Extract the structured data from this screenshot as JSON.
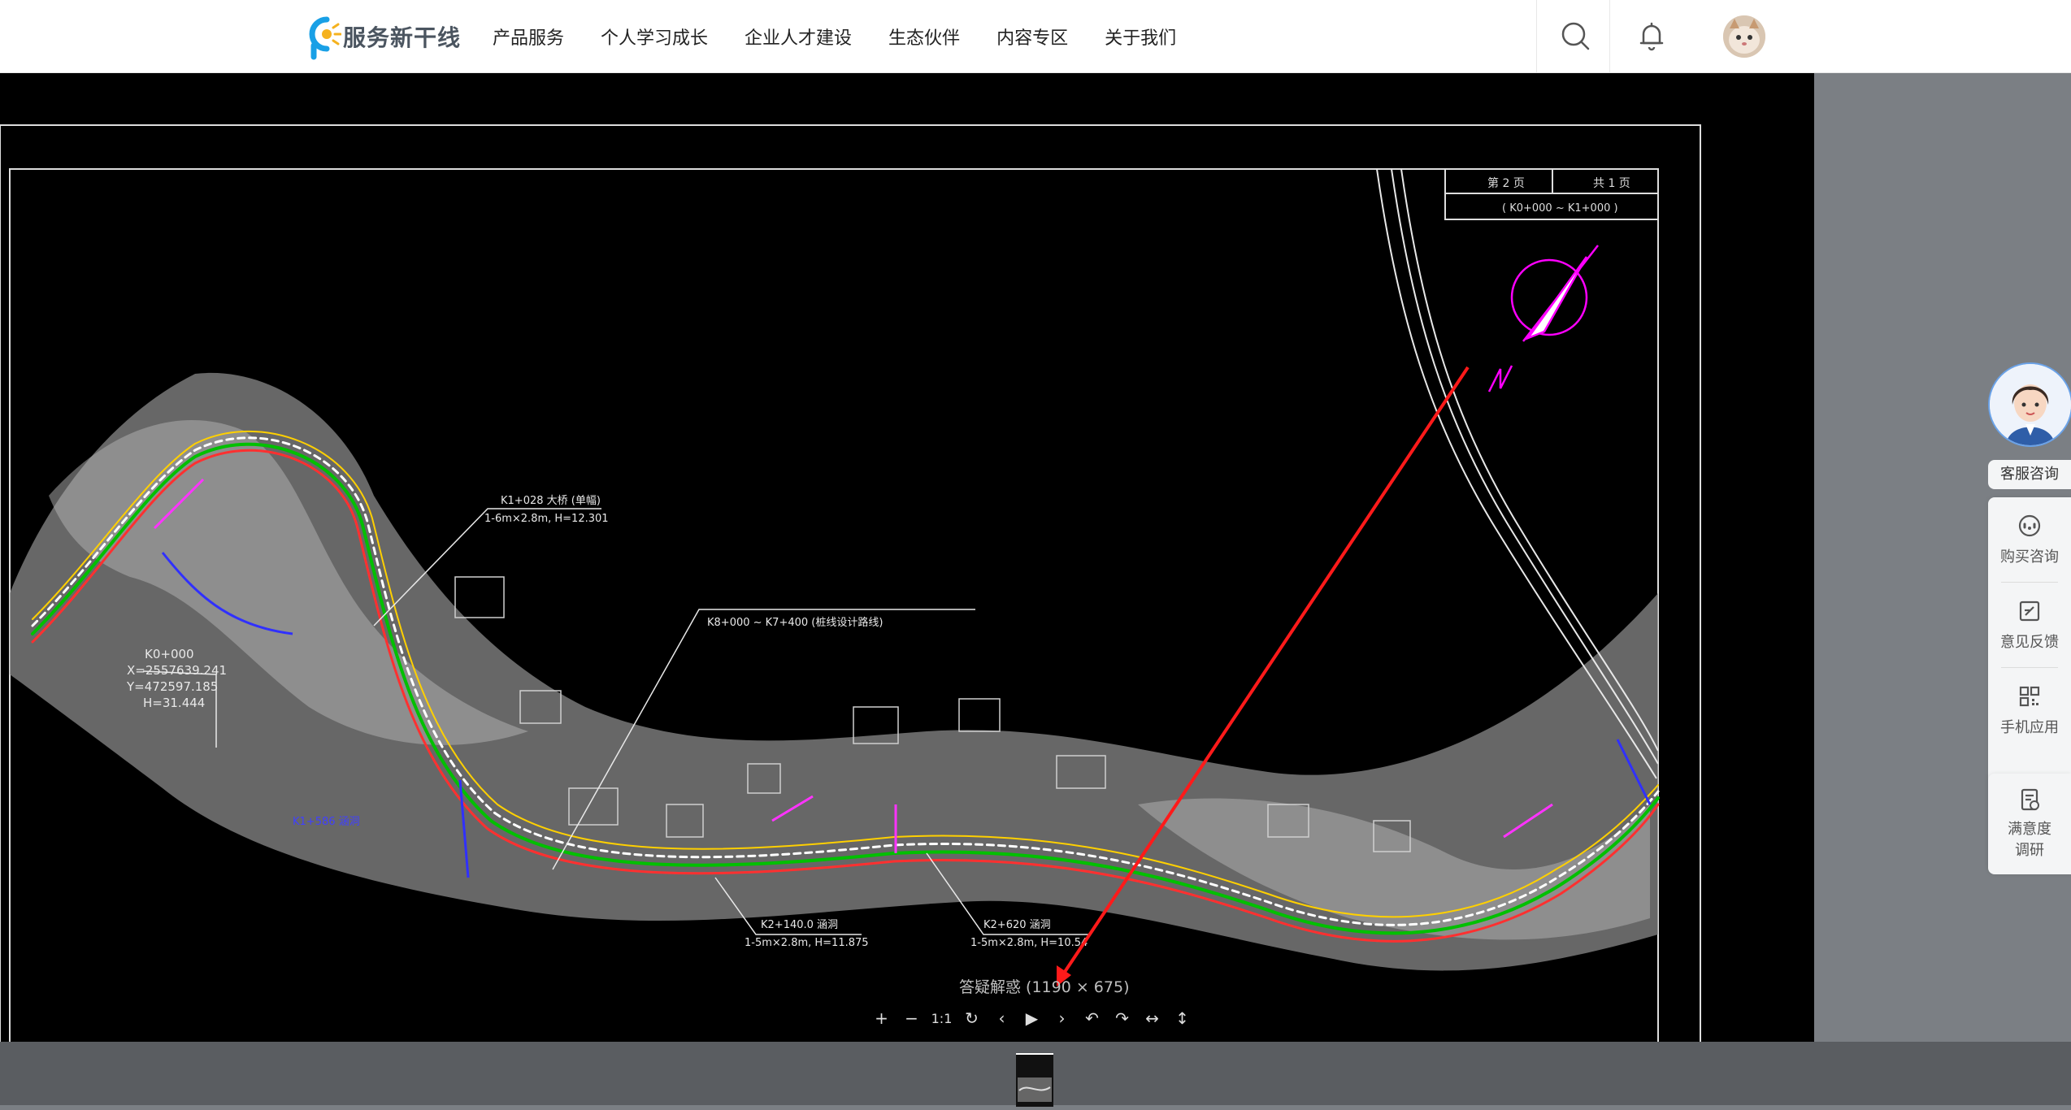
{
  "header": {
    "logo_text": "服务新干线",
    "nav": [
      "产品服务",
      "个人学习成长",
      "企业人才建设",
      "生态伙伴",
      "内容专区",
      "关于我们"
    ],
    "search_icon": "search-icon",
    "bell_icon": "bell-icon"
  },
  "viewer": {
    "caption": "答疑解惑 (1190 × 675)",
    "toolbar": [
      {
        "name": "zoom-in-button",
        "glyph": "+"
      },
      {
        "name": "zoom-out-button",
        "glyph": "−"
      },
      {
        "name": "actual-size-button",
        "glyph": "1:1"
      },
      {
        "name": "reset-button",
        "glyph": "↻"
      },
      {
        "name": "prev-button",
        "glyph": "‹"
      },
      {
        "name": "play-button",
        "glyph": "▶"
      },
      {
        "name": "next-button",
        "glyph": "›"
      },
      {
        "name": "rotate-left-button",
        "glyph": "↶"
      },
      {
        "name": "rotate-right-button",
        "glyph": "↷"
      },
      {
        "name": "flip-horizontal-button",
        "glyph": "↔"
      },
      {
        "name": "flip-vertical-button",
        "glyph": "↕"
      }
    ],
    "drawing": {
      "title_block": [
        "第 2 页",
        "共 1 页",
        "( K0+000 ~ K1+000 )"
      ],
      "labels": [
        "K0+000",
        "X=2557639.241",
        "Y=472597.185",
        "H=31.444",
        "K1+028 大桥 (单幅)",
        "1-6m×2.8m, H=12.301",
        "K8+000 ~ K7+400 (桩线设计路线)",
        "K2+140.0 涵洞",
        "1-5m×2.8m, H=11.875",
        "K2+620 涵洞",
        "1-5m×2.8m, H=10.54"
      ]
    }
  },
  "side": {
    "service_label": "客服咨询",
    "items": [
      {
        "label": "购买咨询",
        "icon": "headset-icon"
      },
      {
        "label": "意见反馈",
        "icon": "edit-icon"
      },
      {
        "label": "手机应用",
        "icon": "qrcode-icon"
      },
      {
        "label": "满意度调研",
        "icon": "survey-icon"
      }
    ]
  },
  "colors": {
    "accent": "#ff0000",
    "magenta": "#ff00ff",
    "road_green": "#00c000"
  }
}
